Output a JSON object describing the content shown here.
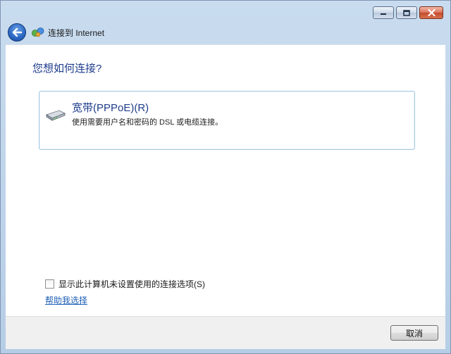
{
  "window": {
    "title": "连接到 Internet"
  },
  "content": {
    "question": "您想如何连接?"
  },
  "option": {
    "title": "宽带(PPPoE)(R)",
    "description": "使用需要用户名和密码的 DSL 或电缆连接。"
  },
  "checkbox": {
    "label": "显示此计算机未设置使用的连接选项(S)",
    "checked": false
  },
  "help_link": "帮助我选择",
  "footer": {
    "cancel_label": "取消"
  },
  "icons": {
    "back": "back-arrow-icon",
    "network": "network-globe-icon",
    "modem": "broadband-modem-icon",
    "minimize": "minimize-icon",
    "maximize": "maximize-icon",
    "close": "close-icon"
  },
  "colors": {
    "heading_blue": "#1e3c8c",
    "link_blue": "#1f5fb7",
    "card_border": "#a8cde6"
  }
}
